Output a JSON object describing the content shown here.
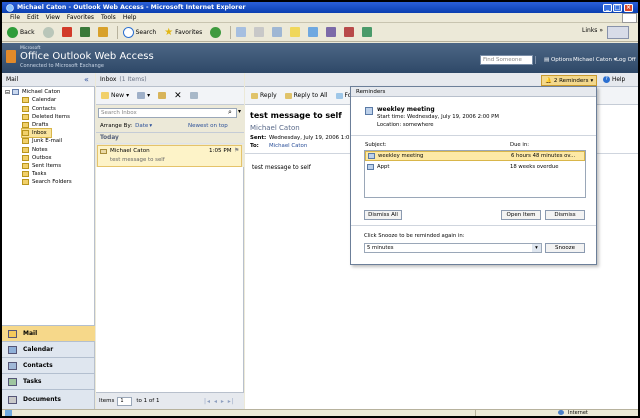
{
  "window": {
    "title": "Michael Caton - Outlook Web Access - Microsoft Internet Explorer"
  },
  "menu": [
    "File",
    "Edit",
    "View",
    "Favorites",
    "Tools",
    "Help"
  ],
  "toolbar": {
    "back": "Back",
    "search": "Search",
    "favorites": "Favorites",
    "links": "Links"
  },
  "owa": {
    "ms": "Microsoft",
    "brand": "Office Outlook Web Access",
    "sub": "Connected to Microsoft Exchange",
    "find_placeholder": "Find Someone",
    "options": "Options",
    "user": "Michael Caton",
    "logoff": "Log Off"
  },
  "mail": {
    "title": "Mail",
    "collapse": "«"
  },
  "folders": {
    "root": "Michael Caton",
    "items": [
      "Calendar",
      "Contacts",
      "Deleted Items",
      "Drafts",
      "Inbox",
      "Junk E-mail",
      "Notes",
      "Outbox",
      "Sent Items",
      "Tasks",
      "Search Folders"
    ]
  },
  "nav": [
    "Mail",
    "Calendar",
    "Contacts",
    "Tasks",
    "Documents"
  ],
  "inbox": {
    "title": "Inbox",
    "count": "(1 Items)",
    "new": "New",
    "search_placeholder": "Search Inbox",
    "arrange_label": "Arrange By:",
    "arrange_value": "Date",
    "sort": "Newest on top",
    "today": "Today"
  },
  "message": {
    "sender": "Michael Caton",
    "time": "1:05 PM",
    "subject": "test message to self"
  },
  "footer": {
    "items_label": "Items",
    "items_value": "1",
    "of": "to 1 of 1"
  },
  "reading": {
    "reply": "Reply",
    "reply_all": "Reply to All",
    "forward": "For",
    "subject": "test message to self",
    "sender": "Michael Caton",
    "sent_label": "Sent:",
    "sent_value": "Wednesday, July 19, 2006 1:05",
    "to_label": "To:",
    "to_value": "Michael Caton",
    "body": "test message to self"
  },
  "reminders_btn": "2 Reminders",
  "help": "Help",
  "reminders": {
    "title": "Reminders",
    "event": "weekley meeting",
    "start": "Start time: Wednesday, July 19, 2006 2:00 PM",
    "location": "Location: somewhere",
    "subject_col": "Subject:",
    "due_col": "Due in:",
    "rows": [
      {
        "subject": "weekley meeting",
        "due": "6 hours 48 minutes ov..."
      },
      {
        "subject": "Appt",
        "due": "18 weeks overdue"
      }
    ],
    "dismiss_all": "Dismiss All",
    "open_item": "Open Item",
    "dismiss": "Dismiss",
    "snooze_label": "Click Snooze to be reminded again in:",
    "snooze_value": "5 minutes",
    "snooze": "Snooze"
  },
  "status": {
    "zone": "Internet"
  },
  "colors": {
    "title_bar": "#0a3fb0",
    "owa_header": "#3c5677",
    "selected": "#fdf3c8",
    "reminder_btn": "#f3d88c"
  }
}
